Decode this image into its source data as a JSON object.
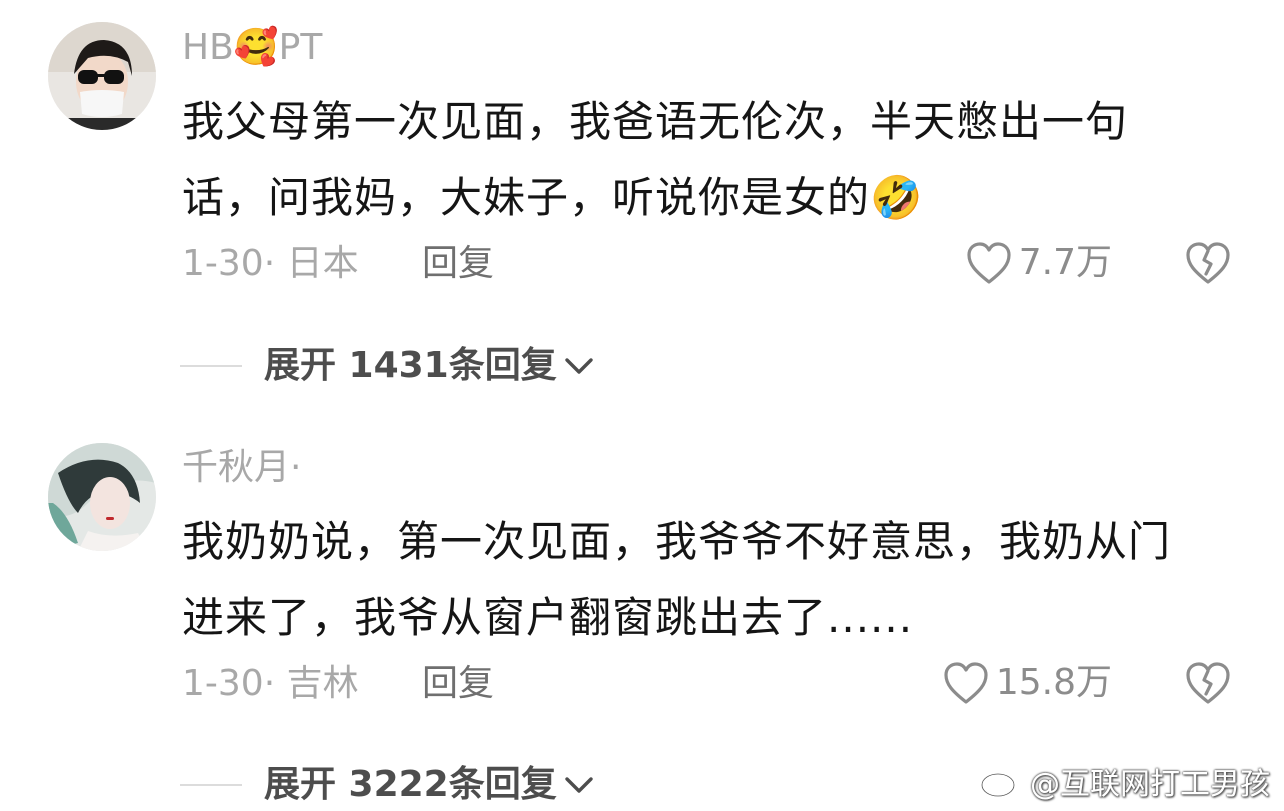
{
  "comments": [
    {
      "username_left": "HB",
      "username_emoji": "🥰",
      "username_right": "PT",
      "text": "我父母第一次见面，我爸语无伦次，半天憋出一句话，问我妈，大妹子，听说你是女的",
      "text_emoji": "🤣",
      "meta": "1-30· 日本",
      "reply_label": "回复",
      "likes": "7.7万",
      "expand_label": "展开 1431条回复"
    },
    {
      "username": "千秋月·",
      "text": "我奶奶说，第一次见面，我爷爷不好意思，我奶从门进来了，我爷从窗户翻窗跳出去了......",
      "meta": "1-30· 吉林",
      "reply_label": "回复",
      "likes": "15.8万",
      "expand_label": "展开 3222条回复"
    }
  ],
  "watermark": {
    "text": "@互联网打工男孩",
    "icon": "weibo-icon"
  },
  "icons": {
    "like": "heart-outline-icon",
    "dislike": "broken-heart-icon",
    "expand": "chevron-down-icon"
  },
  "colors": {
    "meta_gray": "#a8a8a8",
    "text": "#151515",
    "icon_gray": "#8c8c8c"
  }
}
